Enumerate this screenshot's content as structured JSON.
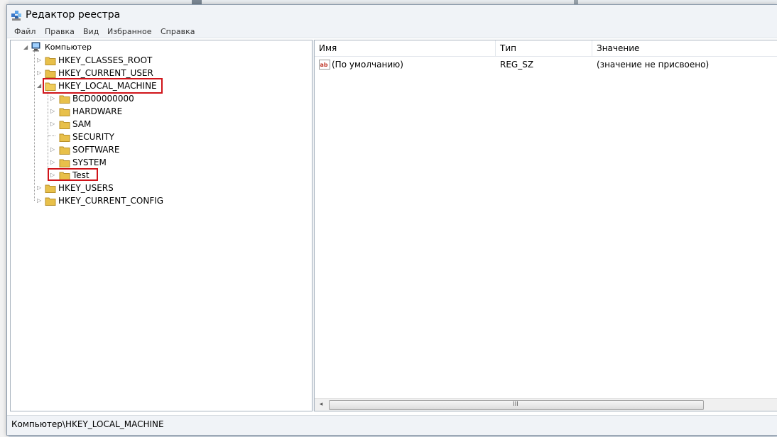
{
  "window": {
    "title": "Редактор реестра",
    "icon": "registry-editor-icon"
  },
  "menu": [
    "Файл",
    "Правка",
    "Вид",
    "Избранное",
    "Справка"
  ],
  "tree": {
    "root": "Компьютер",
    "nodes": [
      {
        "label": "HKEY_CLASSES_ROOT",
        "expander": "collapsed",
        "highlighted": false
      },
      {
        "label": "HKEY_CURRENT_USER",
        "expander": "collapsed",
        "highlighted": false
      },
      {
        "label": "HKEY_LOCAL_MACHINE",
        "expander": "expanded",
        "highlighted": true
      },
      {
        "label": "BCD00000000",
        "expander": "collapsed",
        "highlighted": false
      },
      {
        "label": "HARDWARE",
        "expander": "collapsed",
        "highlighted": false
      },
      {
        "label": "SAM",
        "expander": "collapsed",
        "highlighted": false
      },
      {
        "label": "SECURITY",
        "expander": "none",
        "highlighted": false
      },
      {
        "label": "SOFTWARE",
        "expander": "collapsed",
        "highlighted": false
      },
      {
        "label": "SYSTEM",
        "expander": "collapsed",
        "highlighted": false
      },
      {
        "label": "Test",
        "expander": "collapsed",
        "highlighted": true
      },
      {
        "label": "HKEY_USERS",
        "expander": "collapsed",
        "highlighted": false
      },
      {
        "label": "HKEY_CURRENT_CONFIG",
        "expander": "collapsed",
        "highlighted": false
      }
    ]
  },
  "list": {
    "columns": [
      "Имя",
      "Тип",
      "Значение"
    ],
    "rows": [
      {
        "icon": "string-value-icon",
        "name": "(По умолчанию)",
        "type": "REG_SZ",
        "value": "(значение не присвоено)"
      }
    ],
    "scrollbar_grip": "III"
  },
  "status": {
    "path": "Компьютер\\HKEY_LOCAL_MACHINE"
  },
  "colors": {
    "highlight": "#d0141a",
    "folder": "#e8c04a"
  }
}
